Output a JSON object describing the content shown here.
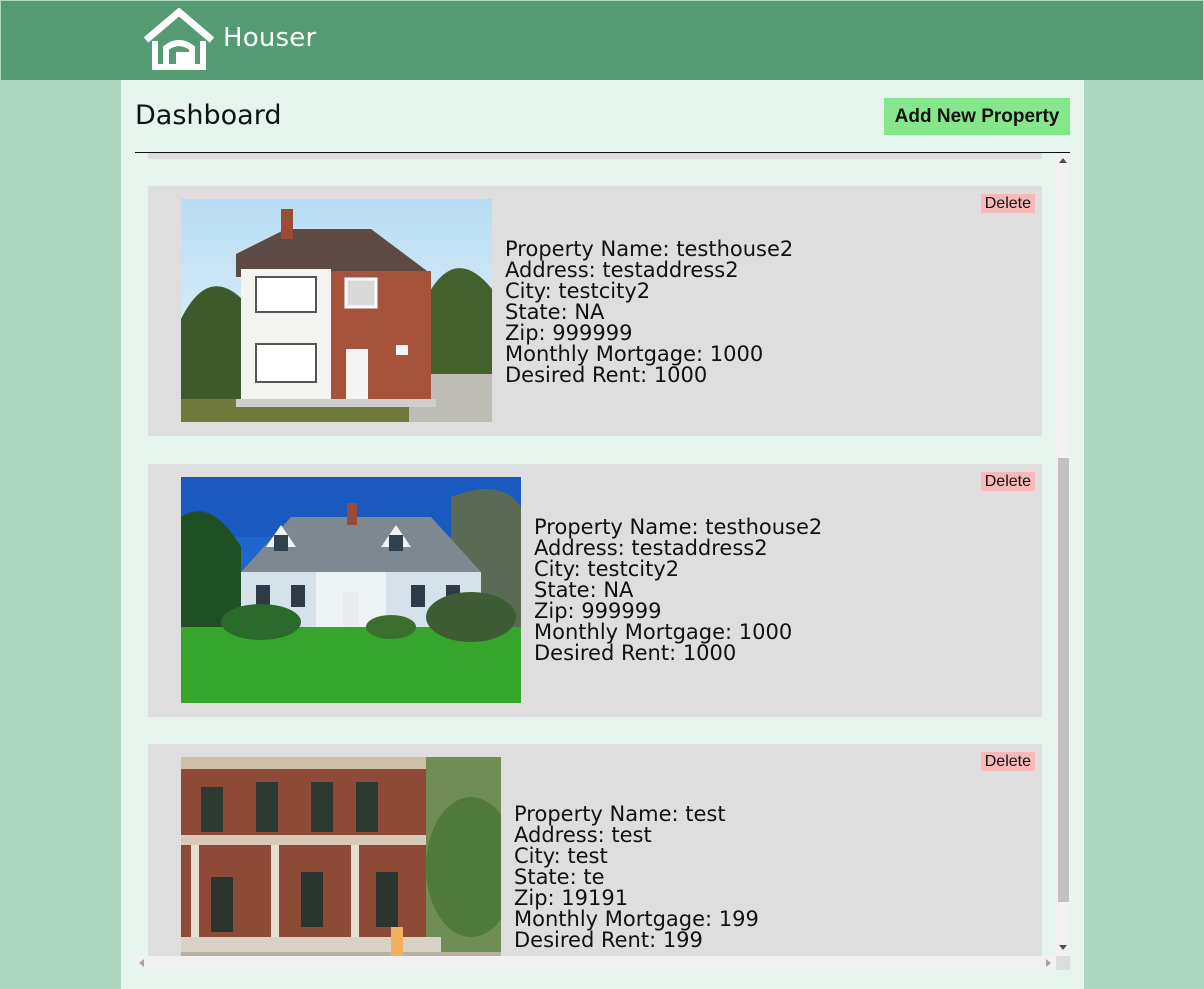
{
  "header": {
    "brand": "Houser",
    "logo_icon": "house-icon"
  },
  "dashboard": {
    "title": "Dashboard",
    "add_button": "Add New Property"
  },
  "properties": [
    {
      "photo": "red-brick-two-story-house-photo",
      "delete_label": "Delete",
      "name": "Property Name: testhouse2",
      "address": "Address: testaddress2",
      "city": "City: testcity2",
      "state": "State: NA",
      "zip": "Zip: 999999",
      "mortgage": "Monthly Mortgage: 1000",
      "rent": "Desired Rent: 1000"
    },
    {
      "photo": "blue-gray-cape-cod-house-photo",
      "delete_label": "Delete",
      "name": "Property Name: testhouse2",
      "address": "Address: testaddress2",
      "city": "City: testcity2",
      "state": "State: NA",
      "zip": "Zip: 999999",
      "mortgage": "Monthly Mortgage: 1000",
      "rent": "Desired Rent: 1000"
    },
    {
      "photo": "brick-italianate-house-with-porch-photo",
      "delete_label": "Delete",
      "name": "Property Name: test",
      "address": "Address: test",
      "city": "City: test",
      "state": "State: te",
      "zip": "Zip: 19191",
      "mortgage": "Monthly Mortgage: 199",
      "rent": "Desired Rent: 199"
    }
  ],
  "colors": {
    "header": "#549b73",
    "page_background": "#afd6c0",
    "panel": "#e5f4ec",
    "card": "#dedede",
    "add_button": "#86e68c",
    "delete_button": "#f6b8b8"
  }
}
